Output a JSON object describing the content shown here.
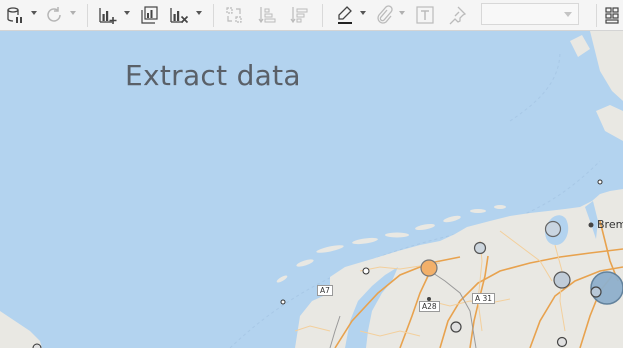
{
  "toolbar": {
    "items": [
      {
        "icon": "datasource-pause-icon",
        "enabled": true
      },
      {
        "icon": "refresh-icon",
        "enabled": false
      },
      {
        "icon": "new-worksheet-icon",
        "enabled": true
      },
      {
        "icon": "duplicate-sheet-icon",
        "enabled": true
      },
      {
        "icon": "clear-sheet-icon",
        "enabled": true
      },
      {
        "icon": "swap-rows-columns-icon",
        "enabled": false
      },
      {
        "icon": "sort-ascending-icon",
        "enabled": false
      },
      {
        "icon": "sort-descending-icon",
        "enabled": false
      },
      {
        "icon": "highlight-icon",
        "enabled": true
      },
      {
        "icon": "group-members-icon",
        "enabled": false
      },
      {
        "icon": "show-mark-labels-icon",
        "enabled": false
      },
      {
        "icon": "pin-icon",
        "enabled": false
      },
      {
        "icon": "show-me-icon",
        "enabled": true
      }
    ],
    "fit_dropdown_value": ""
  },
  "map": {
    "watermark": "Extract data",
    "city_label": "Brem",
    "road_labels": [
      "A7",
      "A28",
      "A 31"
    ],
    "colors": {
      "water": "#b3d3ef",
      "land": "#e9e8e3",
      "motorway": "#e8a24e",
      "mark_orange": "#f2b06a",
      "mark_blue": "#8fb0cc"
    }
  }
}
